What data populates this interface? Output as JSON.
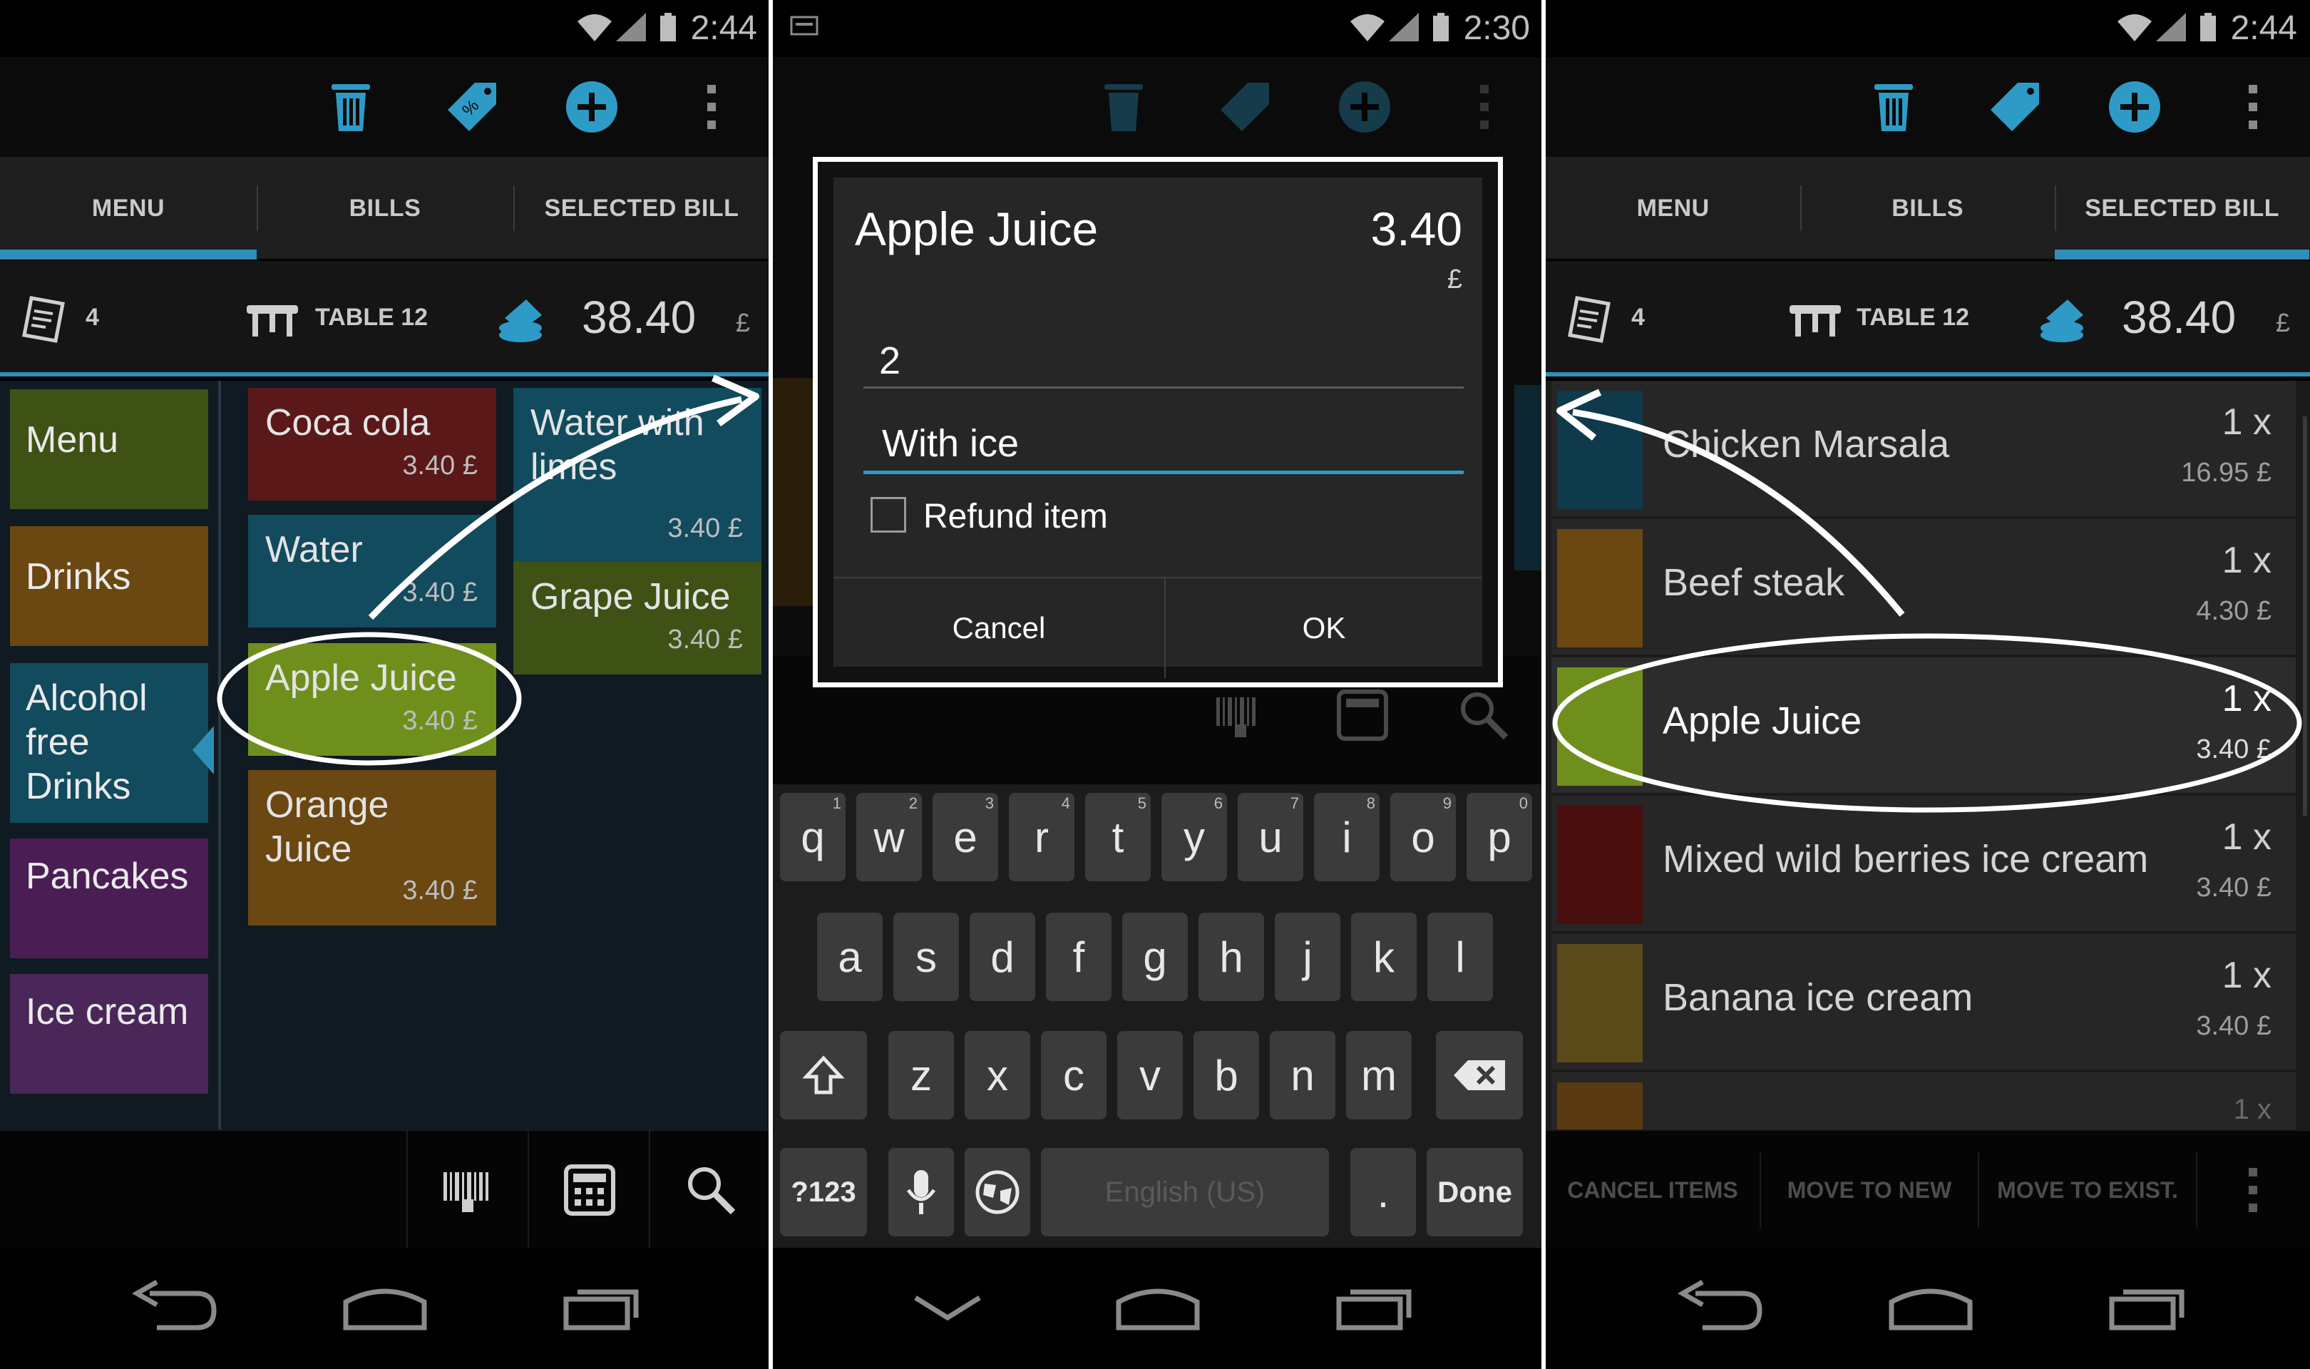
{
  "panel1": {
    "time": "2:44",
    "tabs": [
      "MENU",
      "BILLS",
      "SELECTED BILL"
    ],
    "info": {
      "covers": "4",
      "table": "TABLE 12",
      "total": "38.40",
      "currency": "£"
    },
    "categories": [
      {
        "label": "Menu",
        "color": "#3f5215"
      },
      {
        "label": "Drinks",
        "color": "#6b4712"
      },
      {
        "label": "Alcohol free Drinks",
        "color": "#124a5e"
      },
      {
        "label": "Pancakes",
        "color": "#4a1e55"
      },
      {
        "label": "Ice cream",
        "color": "#4a2659"
      }
    ],
    "products": [
      {
        "name": "Coca cola",
        "price": "3.40 £",
        "color": "#5a1818"
      },
      {
        "name": "Water with limes",
        "price": "3.40 £",
        "color": "#124a5e"
      },
      {
        "name": "Water",
        "price": "3.40 £",
        "color": "#124a5e"
      },
      {
        "name": "Grape Juice",
        "price": "3.40 £",
        "color": "#3f5215"
      },
      {
        "name": "Apple Juice",
        "price": "3.40 £",
        "color": "#6f8f1c"
      },
      {
        "name": "Orange Juice",
        "price": "3.40 £",
        "color": "#6b4712"
      }
    ]
  },
  "panel2": {
    "time": "2:30",
    "dialog": {
      "title": "Apple Juice",
      "price": "3.40",
      "currency": "£",
      "quantity": "2",
      "note": "With ice",
      "refund_label": "Refund item",
      "cancel_label": "Cancel",
      "ok_label": "OK"
    },
    "keyboard": {
      "row1": [
        [
          "q",
          "1"
        ],
        [
          "w",
          "2"
        ],
        [
          "e",
          "3"
        ],
        [
          "r",
          "4"
        ],
        [
          "t",
          "5"
        ],
        [
          "y",
          "6"
        ],
        [
          "u",
          "7"
        ],
        [
          "i",
          "8"
        ],
        [
          "o",
          "9"
        ],
        [
          "p",
          "0"
        ]
      ],
      "row2": [
        "a",
        "s",
        "d",
        "f",
        "g",
        "h",
        "j",
        "k",
        "l"
      ],
      "row3": [
        "z",
        "x",
        "c",
        "v",
        "b",
        "n",
        "m"
      ],
      "symbols_label": "?123",
      "space_label": "English (US)",
      "period_label": ".",
      "done_label": "Done"
    }
  },
  "panel3": {
    "time": "2:44",
    "tabs": [
      "MENU",
      "BILLS",
      "SELECTED BILL"
    ],
    "info": {
      "covers": "4",
      "table": "TABLE 12",
      "total": "38.40",
      "currency": "£"
    },
    "items": [
      {
        "name": "Chicken Marsala",
        "qty": "1 x",
        "price": "16.95 £",
        "color": "#0f3a4c"
      },
      {
        "name": "Beef steak",
        "qty": "1 x",
        "price": "4.30 £",
        "color": "#6b4712"
      },
      {
        "name": "Apple Juice",
        "qty": "1 x",
        "price": "3.40 £",
        "color": "#6f8f1c"
      },
      {
        "name": "Mixed wild berries ice cream",
        "qty": "1 x",
        "price": "3.40 £",
        "color": "#4a0e0e"
      },
      {
        "name": "Banana ice cream",
        "qty": "1 x",
        "price": "3.40 £",
        "color": "#5a4a1a"
      }
    ],
    "partial_qty": "1 x",
    "actions": [
      "CANCEL ITEMS",
      "MOVE TO NEW",
      "MOVE TO EXIST."
    ]
  }
}
